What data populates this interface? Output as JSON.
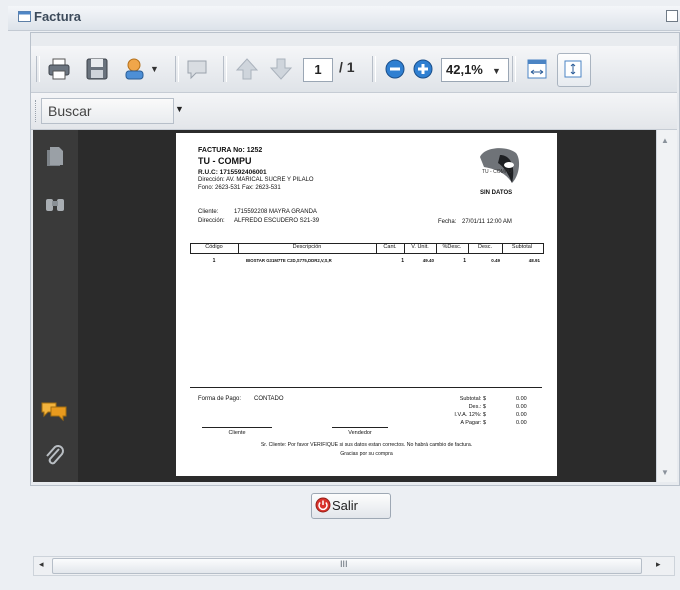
{
  "window": {
    "title": "Factura"
  },
  "toolbar": {
    "current_page": "1",
    "total_pages": "/ 1",
    "zoom": "42,1%"
  },
  "find": {
    "placeholder": "Buscar"
  },
  "invoice": {
    "number_line": "FACTURA No: 1252",
    "company": "TU - COMPU",
    "ruc": "R.U.C: 1715592406001",
    "address": "Dirección: AV. MARICAL SUCRE Y PILALO",
    "phones": "Fono: 2623-531 Fax: 2623-531",
    "logo_caption": "SIN DATOS",
    "client_label": "Cliente:",
    "client_value": "1715592208 MAYRA GRANDA",
    "dir_label": "Dirección:",
    "dir_value": "ALFREDO ESCUDERO S21-39",
    "date_label": "Fecha:",
    "date_value": "27/01/11 12:00 AM",
    "columns": [
      "Código",
      "Descripción",
      "Cant.",
      "V. Unit.",
      "%Desc.",
      "Desc.",
      "Subtotal"
    ],
    "rows": [
      [
        "1",
        "BIOSTAR G31M7TE C2D,S775,DDR2,V,S,R",
        "1",
        "49.40",
        "1",
        "0.49",
        "48.91"
      ]
    ],
    "payment_label": "Forma de Pago:",
    "payment_value": "CONTADO",
    "totals": [
      {
        "label": "Subtotal: $",
        "value": "0.00"
      },
      {
        "label": "Des.: $",
        "value": "0.00"
      },
      {
        "label": "I.V.A. 12%: $",
        "value": "0.00"
      },
      {
        "label": "A Pagar: $",
        "value": "0.00"
      }
    ],
    "sig_client": "Cliente",
    "sig_seller": "Vendedor",
    "footer_1": "Sr. Cliente: Por favor VERIFIQUE si sus datos estan correctos. No habrá cambio de factura.",
    "footer_2": "Gracias por su compra"
  },
  "buttons": {
    "exit_label": "Salir"
  },
  "scrollbar": {
    "grip": "III"
  },
  "colors": {
    "viewer_bg": "#2b2b2b",
    "side_bg": "#3a3a3a",
    "accent_blue": "#2f7fd1",
    "exit_red": "#d9322c"
  }
}
